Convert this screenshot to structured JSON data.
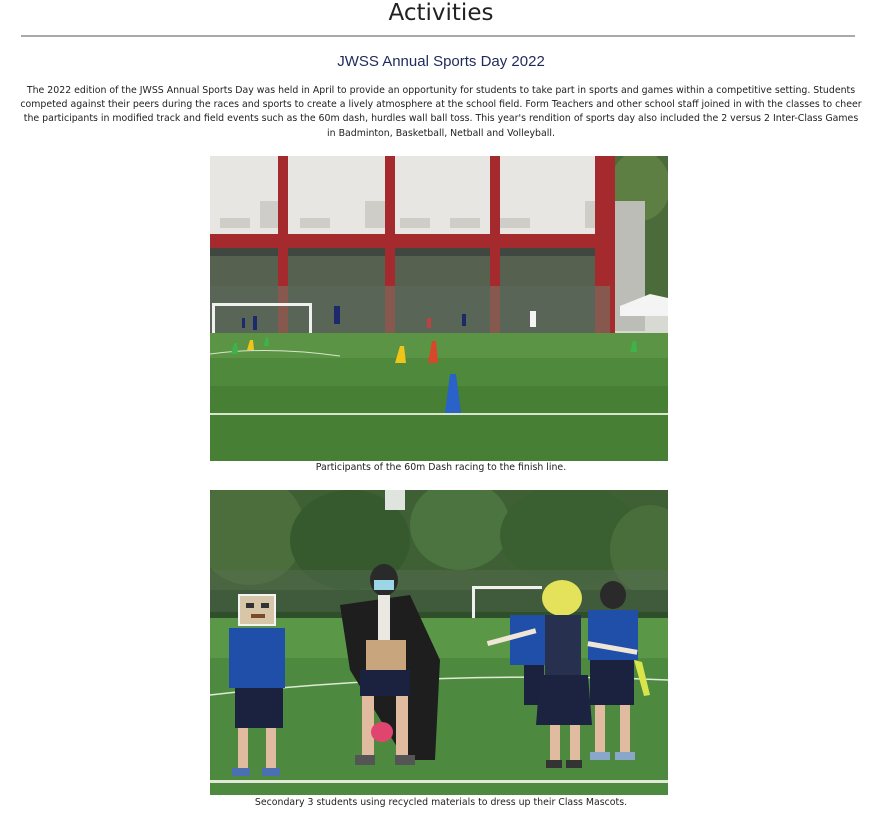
{
  "page": {
    "title": "Activities"
  },
  "article": {
    "heading": "JWSS Annual Sports Day 2022",
    "body": "The 2022 edition of the JWSS Annual Sports Day was held in April to provide an opportunity for students to take part in sports and games within a competitive setting. Students competed against their peers during the races and sports to create a lively atmosphere at the school field. Form Teachers and other school staff joined in with the classes to cheer the participants in modified track and field events such as the 60m dash, hurdles wall ball toss. This year's rendition of sports day also included the 2 versus 2 Inter-Class Games in Badminton, Basketball, Netball and Volleyball."
  },
  "figures": [
    {
      "caption": "Participants of the 60m Dash racing to the finish line."
    },
    {
      "caption": "Secondary 3 students using recycled materials to dress up their Class Mascots."
    }
  ],
  "colors": {
    "heading": "#1f2a5c",
    "text": "#222222",
    "divider": "#a9a9a9",
    "field_green": "#4f8a3c",
    "building_red": "#a52a2e"
  }
}
